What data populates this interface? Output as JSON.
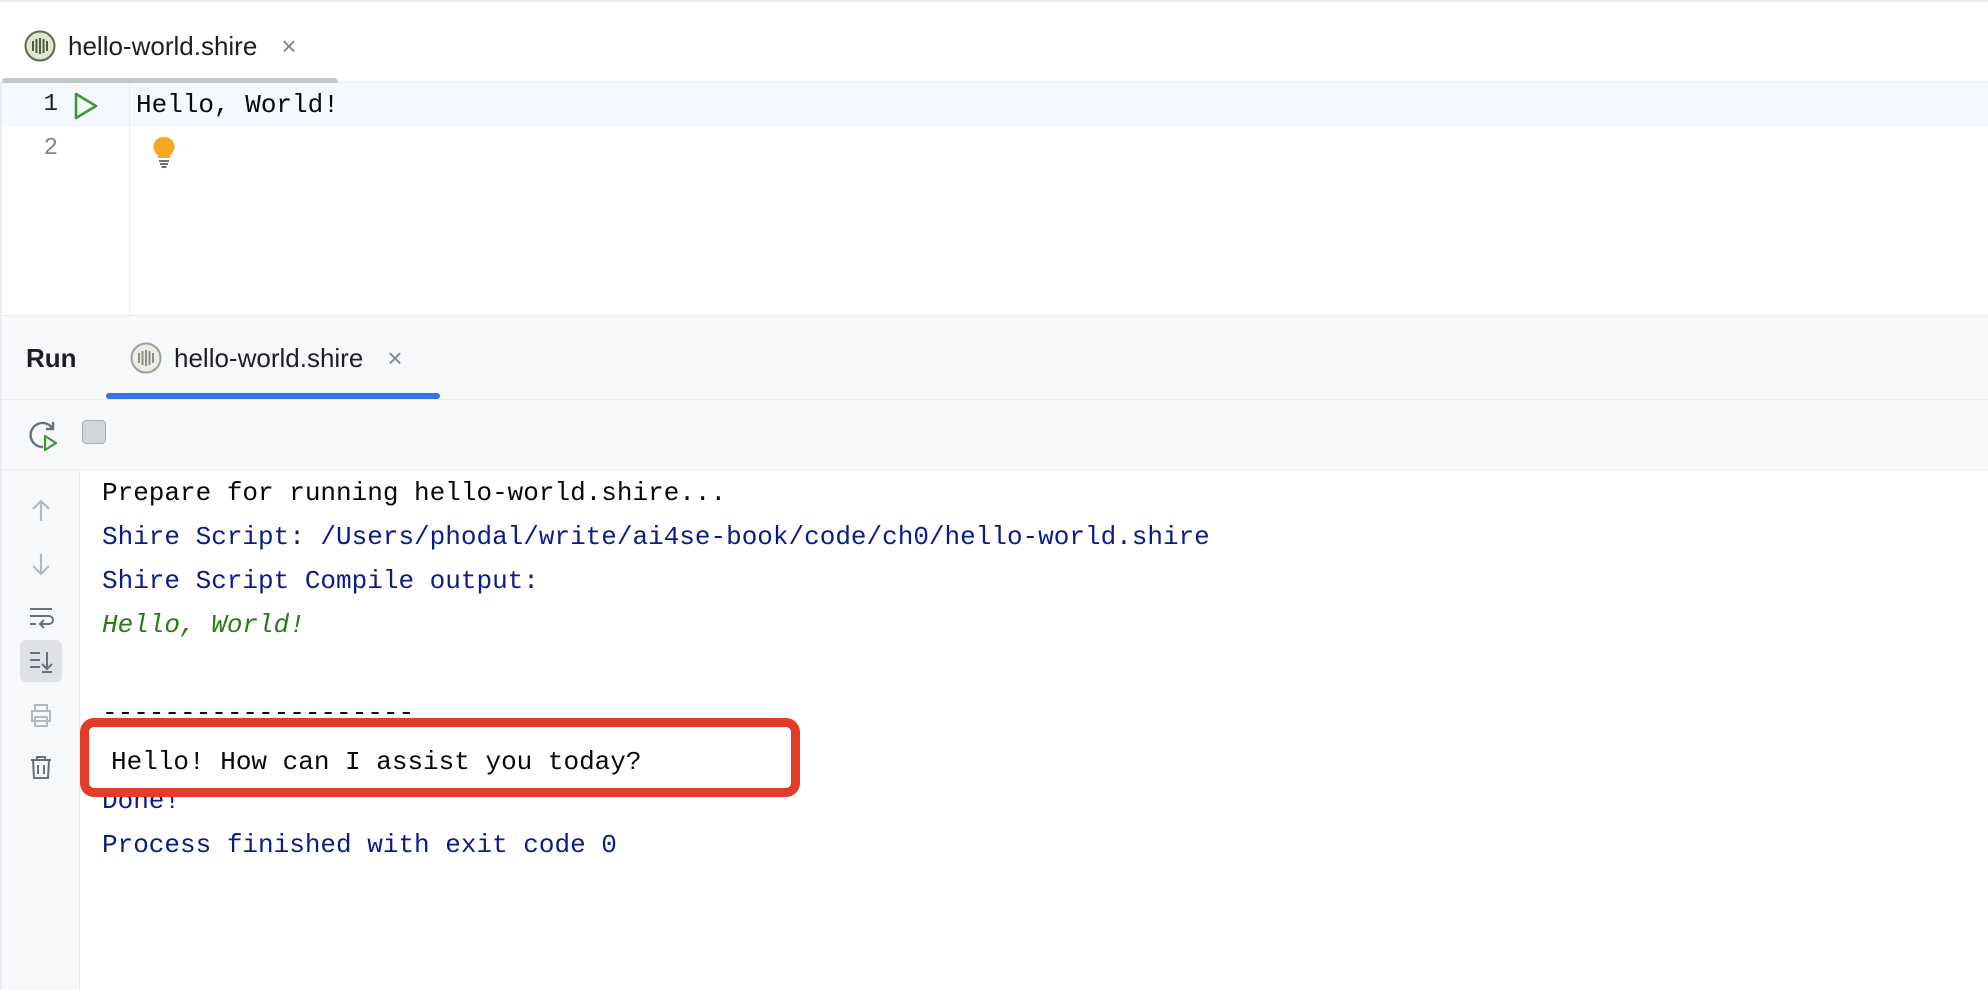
{
  "editor_tab": {
    "label": "hello-world.shire",
    "close_glyph": "×"
  },
  "editor": {
    "line_numbers": [
      "1",
      "2"
    ],
    "lines": [
      "Hello, World!",
      ""
    ]
  },
  "run_window": {
    "title": "Run",
    "tab_label": "hello-world.shire",
    "close_glyph": "×"
  },
  "console": {
    "prepare": "Prepare for running hello-world.shire...",
    "script_path": "Shire Script: /Users/phodal/write/ai4se-book/code/ch0/hello-world.shire",
    "compile_output": "Shire Script Compile output:",
    "compiled": "Hello, World!",
    "separator": "--------------------",
    "response": "Hello! How can I assist you today?",
    "done": "Done!",
    "exit": "Process finished with exit code 0"
  },
  "colors": {
    "accent": "#3574f0",
    "highlight_border": "#e53b29",
    "system_text": "#0b1b8a",
    "green_text": "#287b16"
  },
  "icons": {
    "file": "shire-file-icon",
    "run_gutter": "run-triangle-icon",
    "bulb": "lightbulb-icon",
    "rerun": "rerun-icon",
    "stop": "stop-icon",
    "up": "arrow-up-icon",
    "down": "arrow-down-icon",
    "wrap": "soft-wrap-icon",
    "scroll_end": "scroll-to-end-icon",
    "print": "print-icon",
    "trash": "trash-icon"
  }
}
